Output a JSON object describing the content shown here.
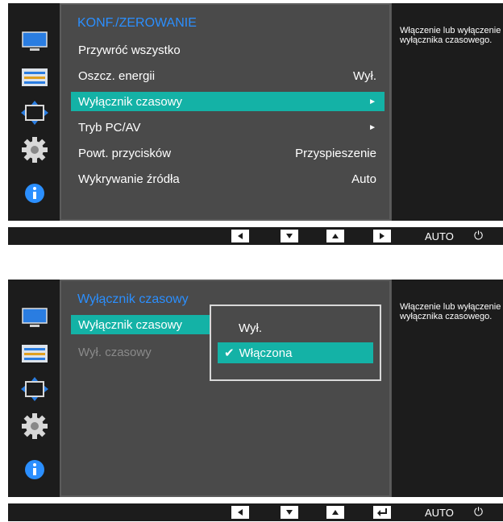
{
  "panel1": {
    "menu_title": "KONF./ZEROWANIE",
    "items": [
      {
        "label": "Przywróć wszystko",
        "value": ""
      },
      {
        "label": "Oszcz. energii",
        "value": "Wył."
      },
      {
        "label": "Wyłącznik czasowy",
        "value": "►"
      },
      {
        "label": "Tryb PC/AV",
        "value": "►"
      },
      {
        "label": "Powt. przycisków",
        "value": "Przyspieszenie"
      },
      {
        "label": "Wykrywanie źródła",
        "value": "Auto"
      }
    ],
    "help": "Włączenie lub wyłączenie wyłącznika czasowego.",
    "bar": {
      "auto": "AUTO",
      "power": "⏻"
    }
  },
  "panel2": {
    "menu_title": "Wyłącznik czasowy",
    "items": [
      {
        "label": "Wyłącznik czasowy"
      },
      {
        "label": "Wył. czasowy"
      }
    ],
    "submenu": [
      {
        "label": "Wył."
      },
      {
        "label": "Włączona",
        "checked": true
      }
    ],
    "help": "Włączenie lub wyłączenie wyłącznika czasowego.",
    "bar": {
      "auto": "AUTO",
      "power": "⏻"
    }
  },
  "colors": {
    "accent_teal": "#14b2a6",
    "title_blue": "#2b8fff",
    "osd_bg": "#4a4a4a"
  },
  "sidebar_icons": [
    "monitor-icon",
    "color-adjust-icon",
    "size-position-icon",
    "gear-icon",
    "info-icon"
  ]
}
